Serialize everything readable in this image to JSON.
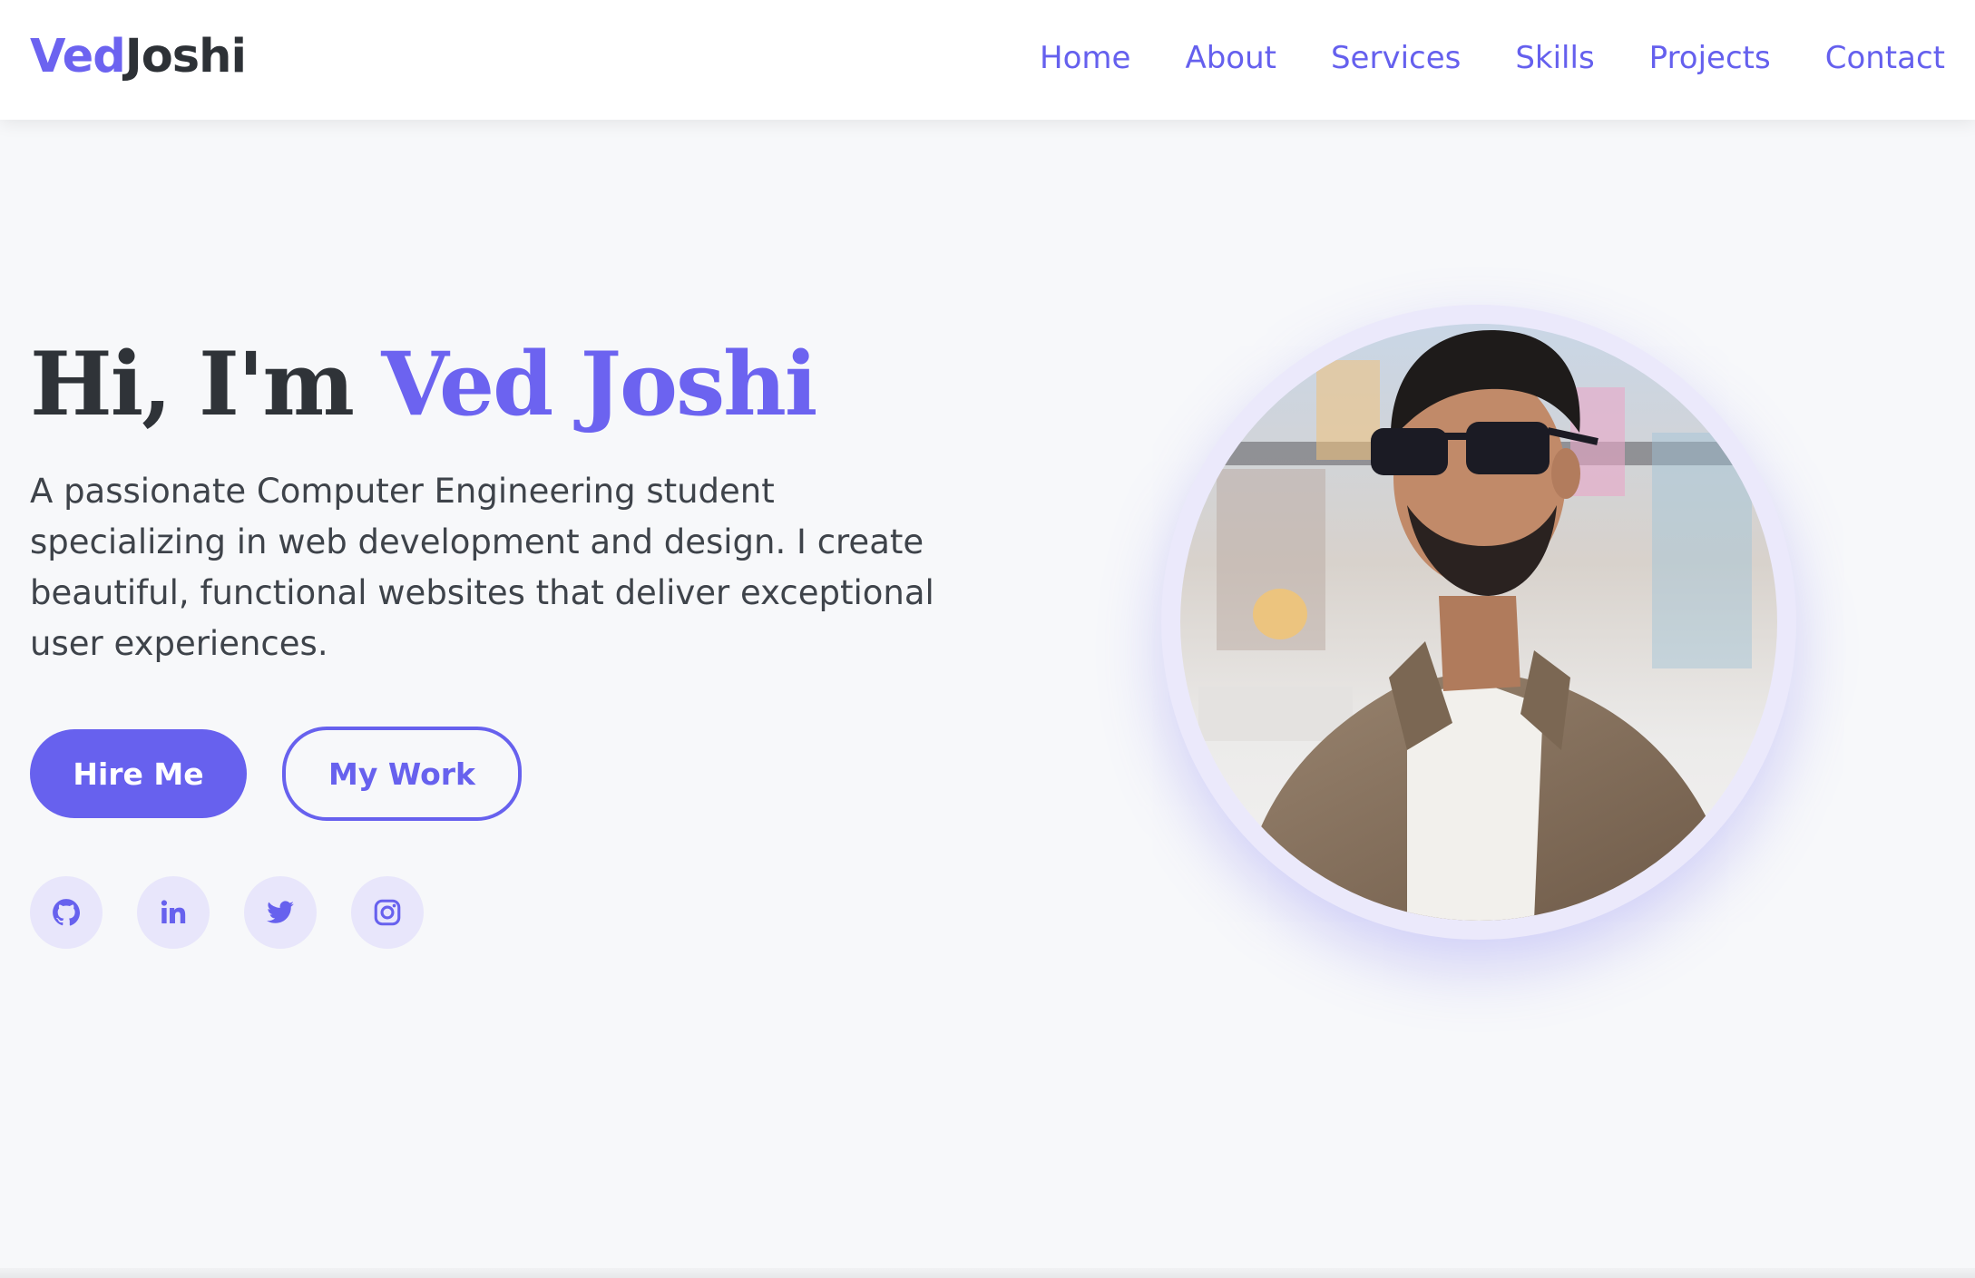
{
  "brand": {
    "first": "Ved",
    "last": "Joshi",
    "accent_color": "#6c63f0"
  },
  "nav": {
    "items": [
      {
        "label": "Home"
      },
      {
        "label": "About"
      },
      {
        "label": "Services"
      },
      {
        "label": "Skills"
      },
      {
        "label": "Projects"
      },
      {
        "label": "Contact"
      }
    ]
  },
  "hero": {
    "greeting": "Hi, I'm ",
    "name": "Ved Joshi",
    "description": "A passionate Computer Engineering student specializing in web development and design. I create beautiful, functional websites that deliver exceptional user experiences.",
    "primary_button": "Hire Me",
    "secondary_button": "My Work"
  },
  "socials": [
    {
      "icon": "github-icon"
    },
    {
      "icon": "linkedin-icon"
    },
    {
      "icon": "twitter-icon"
    },
    {
      "icon": "instagram-icon"
    }
  ],
  "portrait": {
    "icon": "profile-photo"
  }
}
